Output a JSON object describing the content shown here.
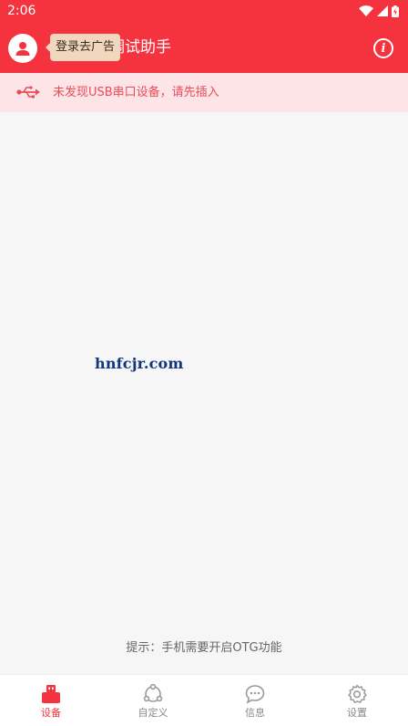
{
  "status_bar": {
    "time": "2:06"
  },
  "app_bar": {
    "title": "调试助手",
    "login_tip": "登录去广告"
  },
  "notice": {
    "text": "未发现USB串口设备，请先插入"
  },
  "watermark": "hnfcjr.com",
  "hint": "提示：手机需要开启OTG功能",
  "bottom_nav": {
    "items": [
      {
        "label": "设备",
        "icon": "usb-device-icon",
        "active": true
      },
      {
        "label": "自定义",
        "icon": "custom-nodes-icon",
        "active": false
      },
      {
        "label": "信息",
        "icon": "chat-bubble-icon",
        "active": false
      },
      {
        "label": "设置",
        "icon": "gear-icon",
        "active": false
      }
    ]
  },
  "colors": {
    "primary": "#f5333f",
    "notice_bg": "#fde4e6",
    "notice_text": "#ea4c5a",
    "tip_bg": "#f1d7bd"
  }
}
